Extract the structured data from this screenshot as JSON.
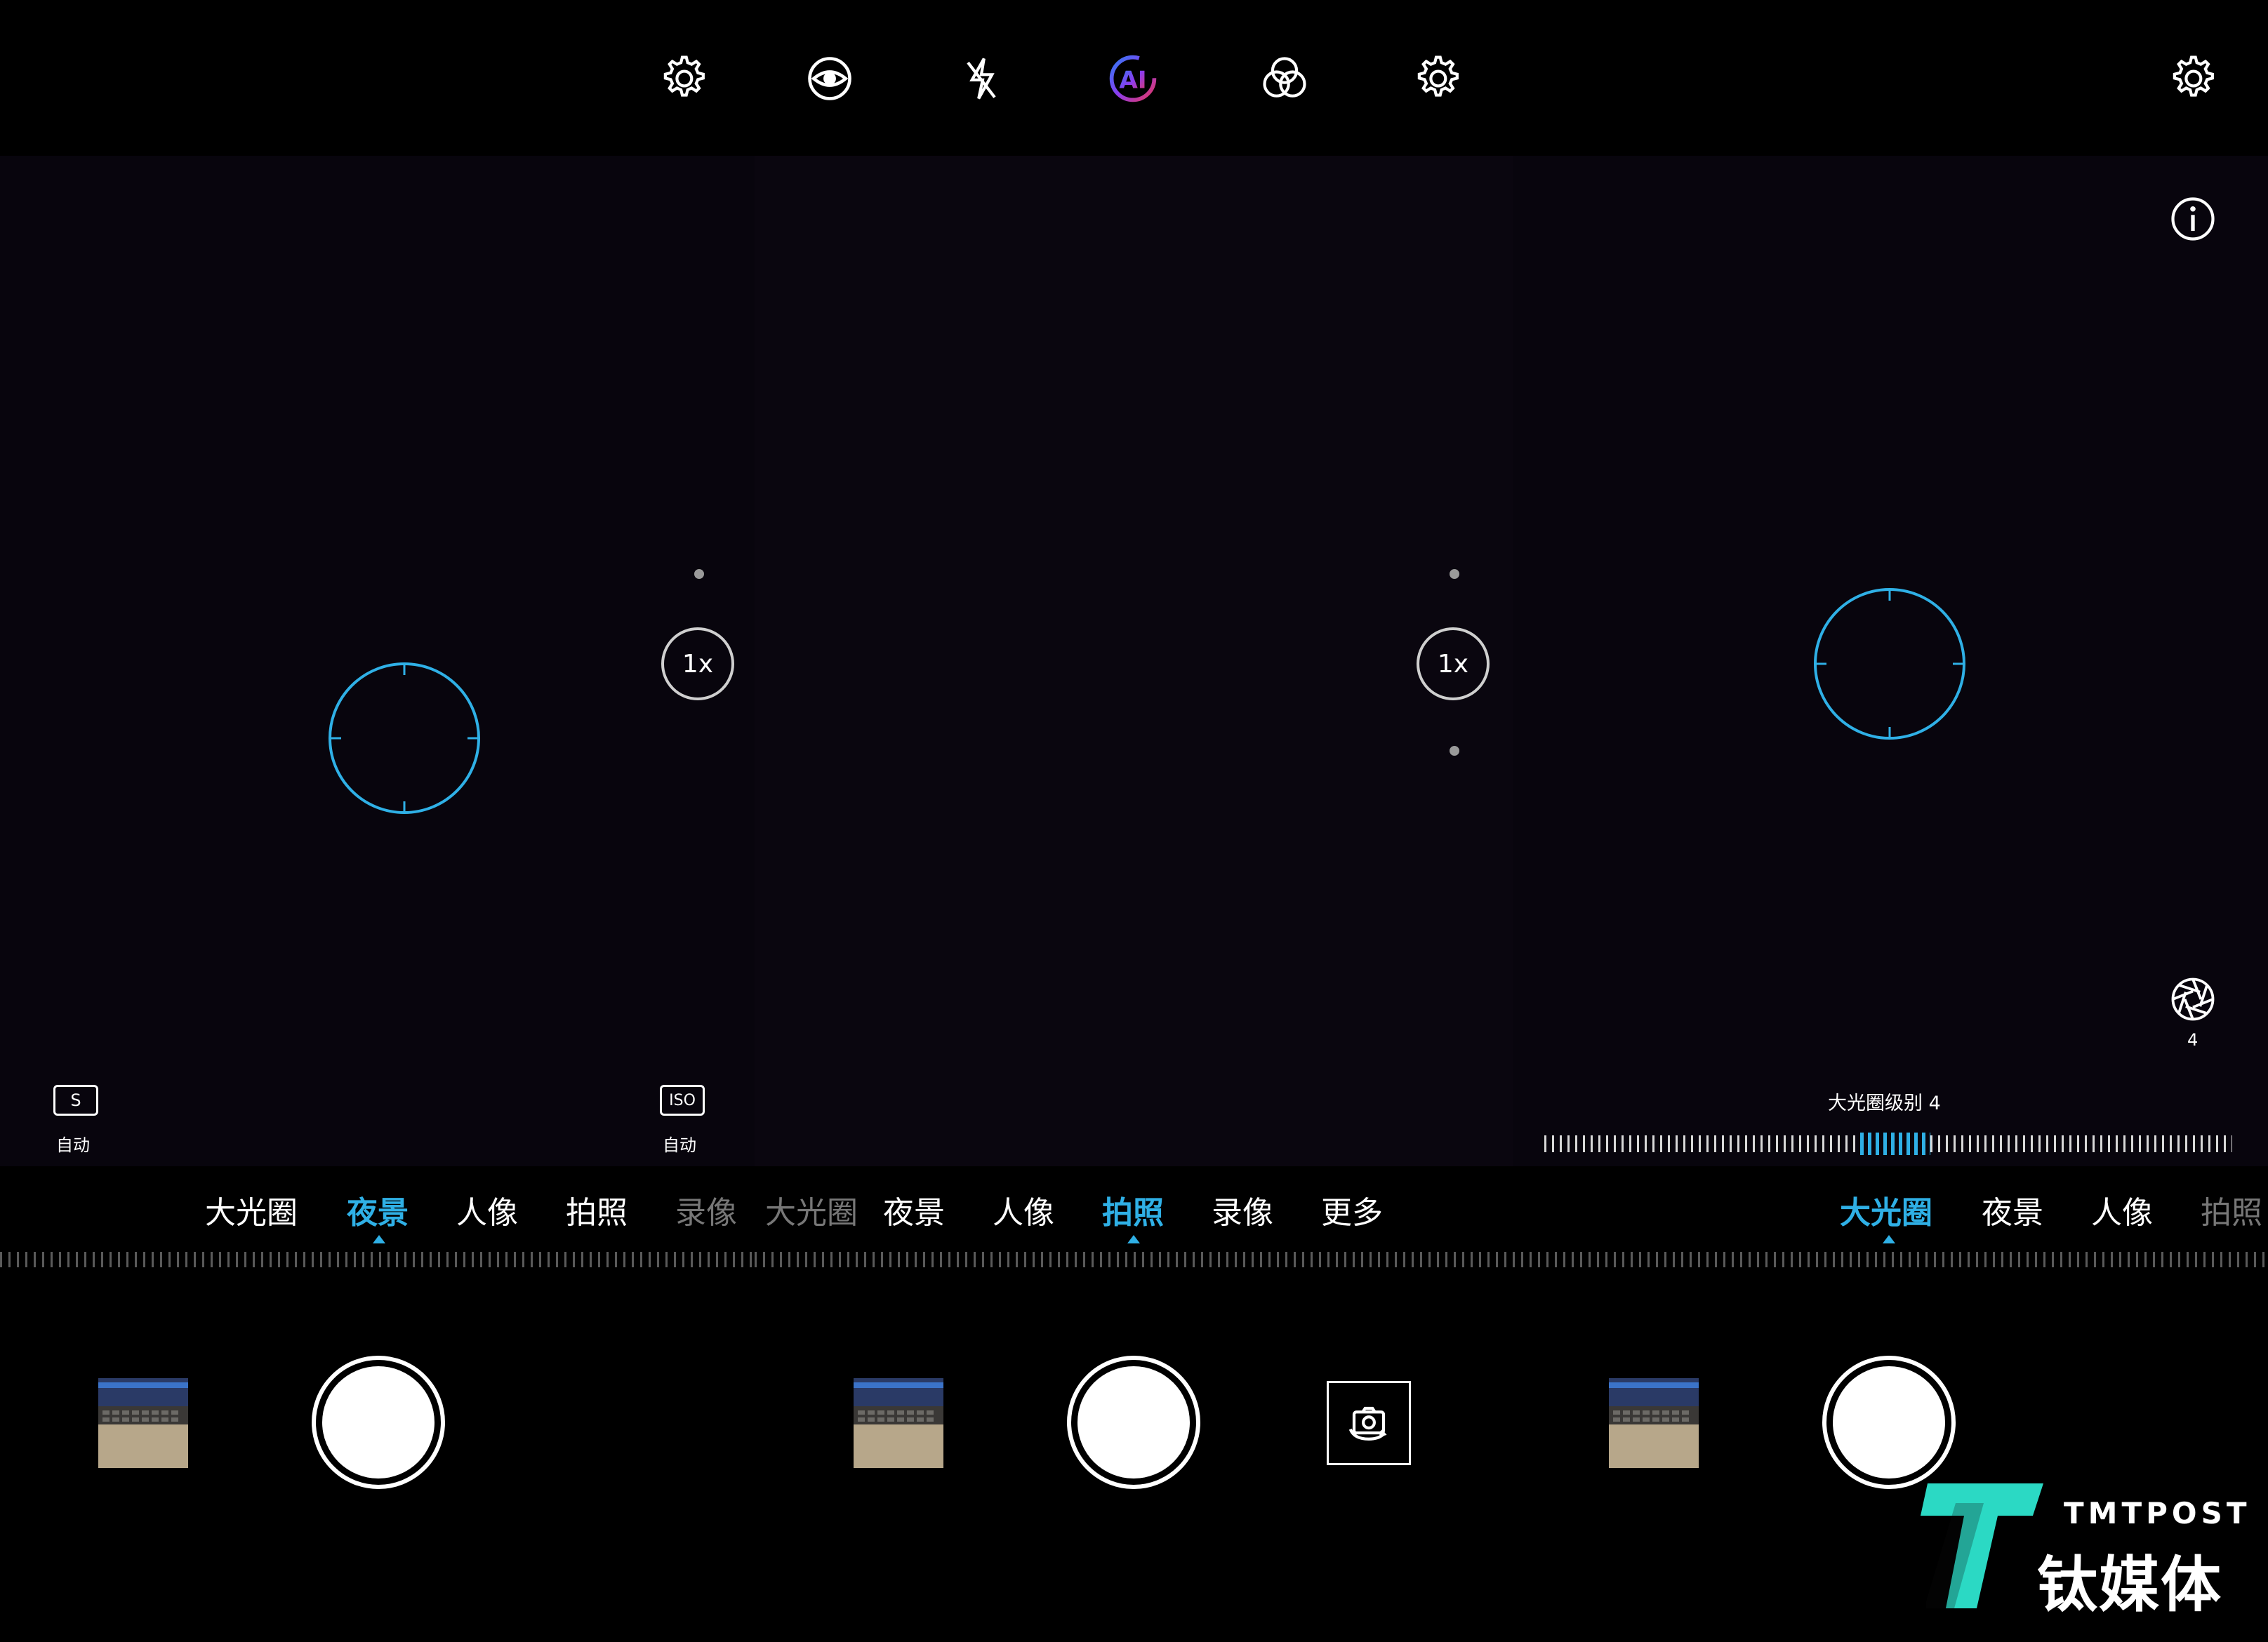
{
  "colors": {
    "accent": "#2fb0e6",
    "background": "#000000",
    "viewfinder": "#08050d"
  },
  "top_icons": [
    "settings-icon",
    "aperture-eye-icon",
    "flash-off-icon",
    "ai-icon",
    "filter-icon",
    "settings-icon",
    "settings-icon"
  ],
  "zoom": {
    "left_label": "1x",
    "center_label": "1x"
  },
  "night_params": {
    "shutter": {
      "box": "S",
      "value": "自动"
    },
    "iso": {
      "box": "ISO",
      "value": "自动"
    }
  },
  "aperture": {
    "icon_value": "4",
    "level_label": "大光圈级别 4",
    "level": 4
  },
  "panel1_modes": [
    "大光圈",
    "夜景",
    "人像",
    "拍照",
    "录像"
  ],
  "panel2_modes": [
    "大光圈",
    "夜景",
    "人像",
    "拍照",
    "录像",
    "更多"
  ],
  "panel3_modes": [
    "大光圈",
    "夜景",
    "人像",
    "拍照"
  ],
  "active_modes": {
    "panel1": "夜景",
    "panel2": "拍照",
    "panel3": "大光圈"
  },
  "watermark": {
    "brand_en": "TMTPOST",
    "brand_cn": "钛媒体"
  }
}
